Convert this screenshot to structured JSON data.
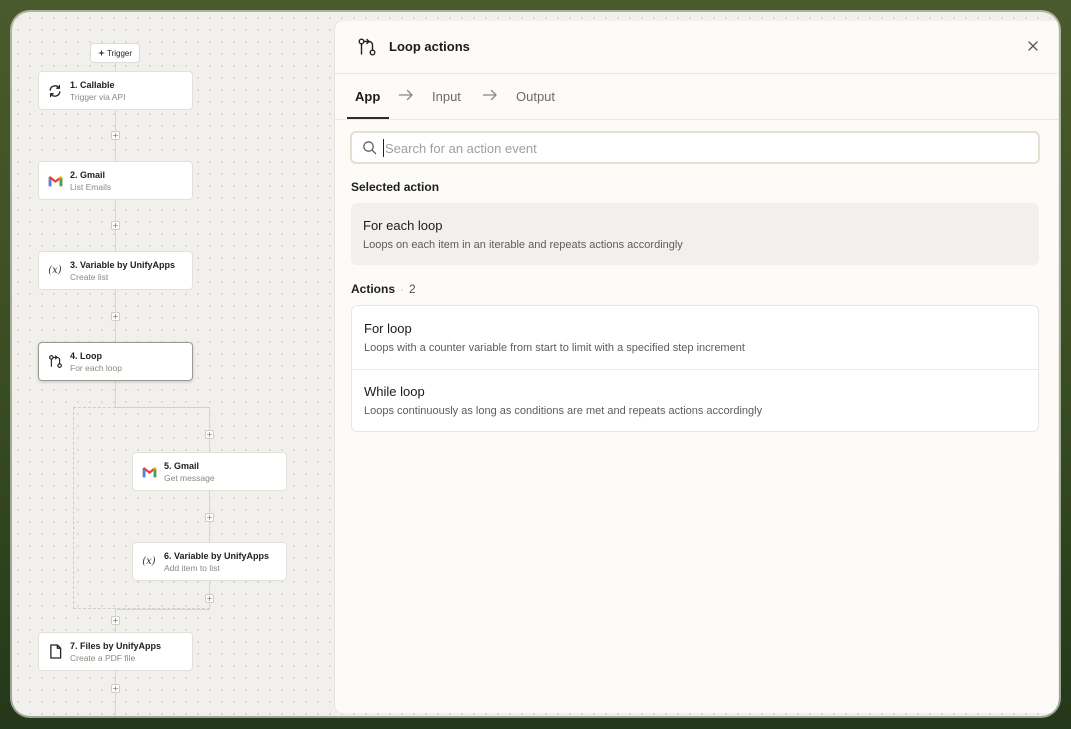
{
  "canvas": {
    "trigger_label": "Trigger",
    "nodes": [
      {
        "title": "1. Callable",
        "subtitle": "Trigger via API",
        "icon": "refresh-icon"
      },
      {
        "title": "2. Gmail",
        "subtitle": "List Emails",
        "icon": "gmail-icon"
      },
      {
        "title": "3. Variable by UnifyApps",
        "subtitle": "Create list",
        "icon": "variable-icon"
      },
      {
        "title": "4. Loop",
        "subtitle": "For each loop",
        "icon": "loop-icon"
      },
      {
        "title": "5. Gmail",
        "subtitle": "Get message",
        "icon": "gmail-icon"
      },
      {
        "title": "6. Variable by UnifyApps",
        "subtitle": "Add item to list",
        "icon": "variable-icon"
      },
      {
        "title": "7. Files by UnifyApps",
        "subtitle": "Create a PDF file",
        "icon": "file-icon"
      }
    ],
    "variable_glyph": "(x)",
    "plus_glyph": "+"
  },
  "panel": {
    "title": "Loop actions",
    "tabs": [
      {
        "label": "App"
      },
      {
        "label": "Input"
      },
      {
        "label": "Output"
      }
    ],
    "search": {
      "placeholder": "Search for an action event",
      "value": ""
    },
    "selected_label": "Selected action",
    "selected": {
      "title": "For each loop",
      "description": "Loops on each item in an iterable and repeats actions accordingly"
    },
    "actions_label": "Actions",
    "actions_count": "2",
    "actions_separator": "·",
    "actions": [
      {
        "title": "For loop",
        "description": "Loops with a counter variable from start to limit with a specified step increment"
      },
      {
        "title": "While loop",
        "description": "Loops continuously as long as conditions are met and repeats actions accordingly"
      }
    ]
  },
  "colors": {
    "accent": "#2b2b2b",
    "search_border": "#e5dfcf",
    "gmail_red": "#EA4335",
    "gmail_blue": "#4285F4",
    "gmail_green": "#34A853",
    "gmail_yellow": "#FBBC04"
  }
}
